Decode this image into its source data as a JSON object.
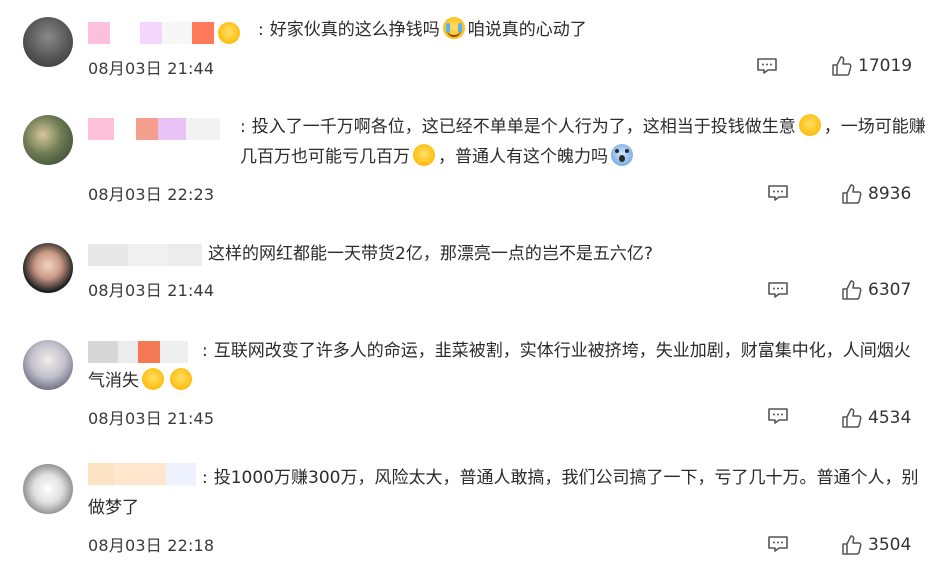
{
  "colors": {
    "text": "#2b2b2b",
    "muted": "#3a3a3a",
    "icon": "#555555"
  },
  "comments": [
    {
      "name_colors": [
        "#ffc0e0",
        "#ffffff",
        "#f4d6ff",
        "#f7f7f7",
        "#ff7a5a"
      ],
      "badge_icon": "heart-face-emoji",
      "text_parts": [
        "好家伙真的这么挣钱吗",
        "咱说真的心动了"
      ],
      "emojis": [
        "crying-emoji"
      ],
      "time": "08月03日 21:44",
      "likes": "17019"
    },
    {
      "name_colors": [
        "#ffc0da",
        "#f5a08e",
        "#e9c3f5",
        "#f2f2f2"
      ],
      "text_parts": [
        "投入了一千万啊各位，这已经不单单是个人行为了，这相当于投钱做生意",
        "，一场可能赚几百万也可能亏几百万",
        "，普通人有这个魄力吗",
        ""
      ],
      "emojis": [
        "laughing-crying-emoji",
        "laughing-crying-emoji",
        "shocked-emoji"
      ],
      "time": "08月03日 22:23",
      "likes": "8936"
    },
    {
      "name_colors": [
        "#e8e8e8",
        "#f0f0f0",
        "#ececec"
      ],
      "text_parts": [
        "这样的网红都能一天带货2亿，那漂亮一点的岂不是五六亿?"
      ],
      "emojis": [],
      "time": "08月03日 21:44",
      "likes": "6307"
    },
    {
      "name_colors": [
        "#d7d7d7",
        "#ececec",
        "#f47a55",
        "#eeeeee"
      ],
      "text_parts": [
        "互联网改变了许多人的命运，韭菜被割，实体行业被挤垮，失业加剧，财富集中化，人间烟火气消失",
        ""
      ],
      "emojis": [
        "laughing-crying-emoji",
        "laughing-crying-emoji"
      ],
      "time": "08月03日 21:45",
      "likes": "4534"
    },
    {
      "name_colors": [
        "#fbe3c4",
        "#ffe6cc",
        "#eef2ff"
      ],
      "text_parts": [
        "投1000万赚300万，风险太大，普通人敢搞，我们公司搞了一下，亏了几十万。普通个人，别做梦了"
      ],
      "emojis": [],
      "time": "08月03日 22:18",
      "likes": "3504"
    }
  ]
}
